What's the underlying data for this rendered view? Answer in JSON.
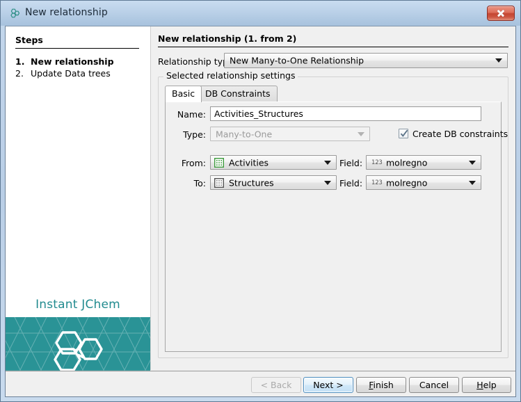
{
  "window": {
    "title": "New relationship",
    "title_icon": "jchem-molecule-icon",
    "close_label": "close-icon",
    "frame_color": "#b9cee6"
  },
  "sidebar": {
    "heading": "Steps",
    "steps": [
      {
        "num": "1.",
        "label": "New relationship",
        "active": true
      },
      {
        "num": "2.",
        "label": "Update Data trees",
        "active": false
      }
    ],
    "brand": {
      "text": "Instant JChem",
      "text_color": "#228b8f",
      "panel_color": "#2a9396",
      "logo_icon": "hexagon-cluster-logo-icon"
    }
  },
  "main": {
    "page_title": "New relationship (1. from 2)",
    "relationship_type": {
      "label": "Relationship type:",
      "value": "New Many-to-One Relationship"
    },
    "groupbox_label": "Selected relationship settings",
    "tabs": [
      {
        "label": "Basic",
        "selected": true
      },
      {
        "label": "DB Constraints",
        "selected": false
      }
    ],
    "form": {
      "name": {
        "label": "Name:",
        "value": "Activities_Structures",
        "placeholder": ""
      },
      "type": {
        "label": "Type:",
        "value": "Many-to-One",
        "disabled": true
      },
      "create_db_constraints": {
        "label": "Create DB constraints",
        "checked": true
      },
      "from": {
        "label": "From:",
        "value": "Activities",
        "icon": "table-icon-green"
      },
      "to": {
        "label": "To:",
        "value": "Structures",
        "icon": "table-icon-gray"
      },
      "from_field": {
        "label": "Field:",
        "type_prefix": "123",
        "value": "molregno"
      },
      "to_field": {
        "label": "Field:",
        "type_prefix": "123",
        "value": "molregno"
      }
    }
  },
  "footer": {
    "buttons": [
      {
        "label": "< Back",
        "state": "disabled"
      },
      {
        "label": "Next >",
        "state": "focused"
      },
      {
        "label": "Finish",
        "state": "normal",
        "mnemonic": "F"
      },
      {
        "label": "Cancel",
        "state": "normal"
      },
      {
        "label": "Help",
        "state": "normal",
        "mnemonic": "H"
      }
    ]
  }
}
